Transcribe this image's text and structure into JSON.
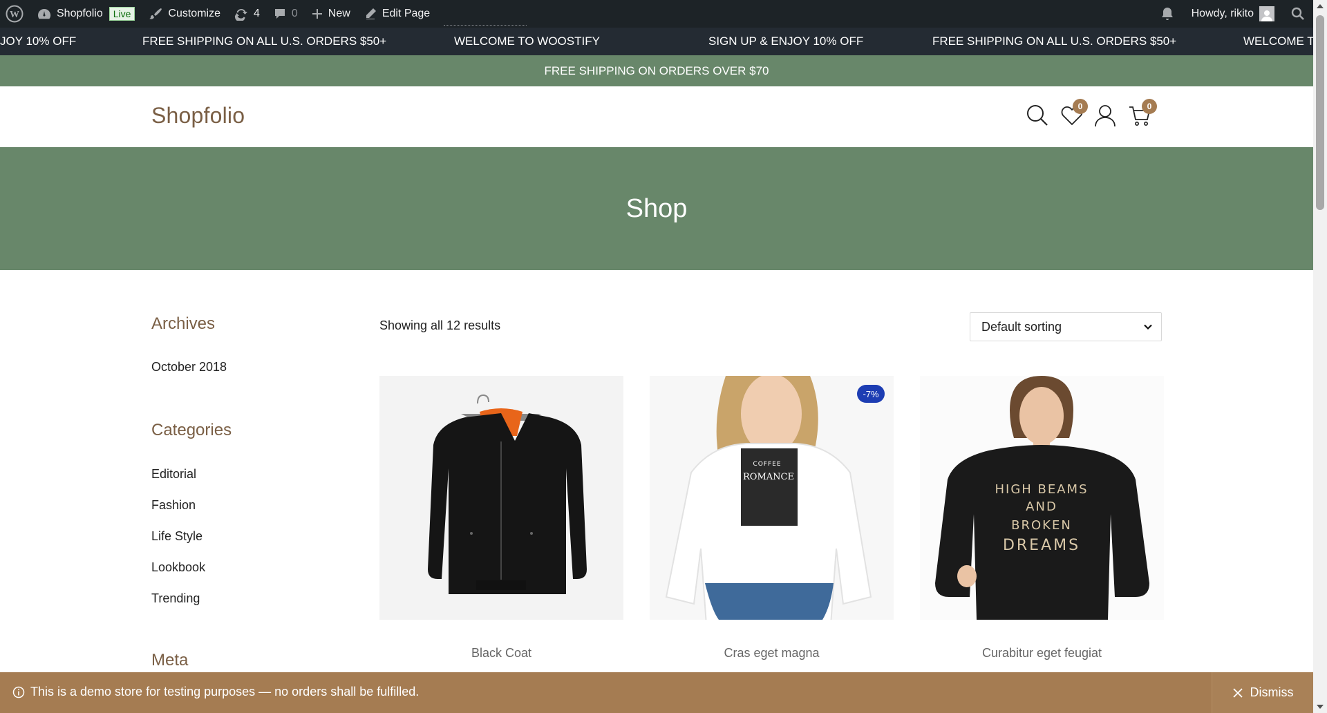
{
  "admin_bar": {
    "site_name": "Shopfolio",
    "live_badge": "Live",
    "customize": "Customize",
    "updates_count": "4",
    "comments_count": "0",
    "new": "New",
    "edit_page": "Edit Page",
    "greeting": "Howdy, rikito"
  },
  "ticker": {
    "items": [
      "JOY 10% OFF",
      "FREE SHIPPING ON ALL U.S. ORDERS $50+",
      "WELCOME TO WOOSTIFY",
      "SIGN UP & ENJOY 10% OFF",
      "FREE SHIPPING ON ALL U.S. ORDERS $50+",
      "WELCOME TO"
    ]
  },
  "topbar": {
    "text": "FREE SHIPPING ON ORDERS OVER $70"
  },
  "header": {
    "logo": "Shopfolio",
    "wishlist_count": "0",
    "cart_count": "0"
  },
  "page": {
    "title": "Shop"
  },
  "sidebar": {
    "archives_title": "Archives",
    "archives": [
      "October 2018"
    ],
    "categories_title": "Categories",
    "categories": [
      "Editorial",
      "Fashion",
      "Life Style",
      "Lookbook",
      "Trending"
    ],
    "meta_title": "Meta"
  },
  "shop": {
    "result_count": "Showing all 12 results",
    "sorting": "Default sorting",
    "products": [
      {
        "name": "Black Coat",
        "badge": ""
      },
      {
        "name": "Cras eget magna",
        "badge": "-7%"
      },
      {
        "name": "Curabitur eget feugiat",
        "badge": ""
      }
    ],
    "print_lines": [
      "COFFEE",
      "ROMANCE"
    ],
    "print_lines_2": [
      "HIGH BEAMS",
      "AND",
      "BROKEN",
      "DREAMS"
    ]
  },
  "notice": {
    "text": "This is a demo store for testing purposes — no orders shall be fulfilled.",
    "dismiss": "Dismiss"
  },
  "colors": {
    "admin_bar": "#1d2327",
    "ticker": "#242b33",
    "green": "#68876a",
    "brown": "#a57c52",
    "sale_badge": "#1d3db3"
  }
}
